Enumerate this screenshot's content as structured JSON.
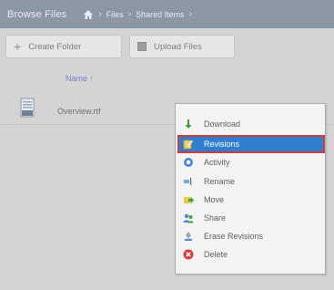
{
  "titlebar": {
    "title": "Browse Files",
    "breadcrumbs": [
      "Files",
      "Shared Items"
    ]
  },
  "toolbar": {
    "create_folder_label": "Create Folder",
    "upload_files_label": "Upload Files"
  },
  "list": {
    "column_header": "Name ↑",
    "rows": [
      {
        "name": "Overview.rtf"
      }
    ]
  },
  "context_menu": {
    "items": [
      {
        "label": "Download",
        "icon": "download-icon"
      },
      {
        "label": "Revisions",
        "icon": "revisions-icon",
        "selected": true
      },
      {
        "label": "Activity",
        "icon": "activity-icon"
      },
      {
        "label": "Rename",
        "icon": "rename-icon"
      },
      {
        "label": "Move",
        "icon": "move-icon"
      },
      {
        "label": "Share",
        "icon": "share-icon"
      },
      {
        "label": "Erase Revisions",
        "icon": "erase-revisions-icon"
      },
      {
        "label": "Delete",
        "icon": "delete-icon"
      }
    ]
  },
  "colors": {
    "titlebar_bg": "#8b97a4",
    "selected_bg": "#2e7fd0",
    "highlight_border": "#d43b3b",
    "header_link": "#7a83c9"
  }
}
